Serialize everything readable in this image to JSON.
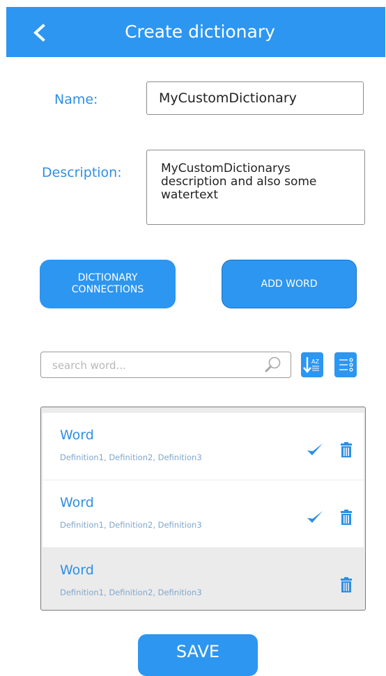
{
  "header": {
    "title": "Create dictionary",
    "back_icon": "chevron-left"
  },
  "form": {
    "name_label": "Name:",
    "name_value": "MyCustomDictionary",
    "description_label": "Description:",
    "description_value": "MyCustomDictionarys description and also some watertext"
  },
  "actions": {
    "connections_label": "DICTIONARY\nCONNECTIONS",
    "add_word_label": "ADD WORD"
  },
  "search": {
    "placeholder": "search word...",
    "sort_icon": "sort-az",
    "filter_icon": "filter-list"
  },
  "words": [
    {
      "word": "Word",
      "definitions": "Definition1, Definition2, Definition3",
      "checked": true
    },
    {
      "word": "Word",
      "definitions": "Definition1, Definition2, Definition3",
      "checked": true
    },
    {
      "word": "Word",
      "definitions": "Definition1, Definition2, Definition3",
      "checked": false
    }
  ],
  "save_label": "SAVE",
  "colors": {
    "primary": "#2d96f0",
    "text_blue": "#2d8fe5",
    "definition": "#7fa7cc",
    "list_bg": "#ebebeb"
  }
}
